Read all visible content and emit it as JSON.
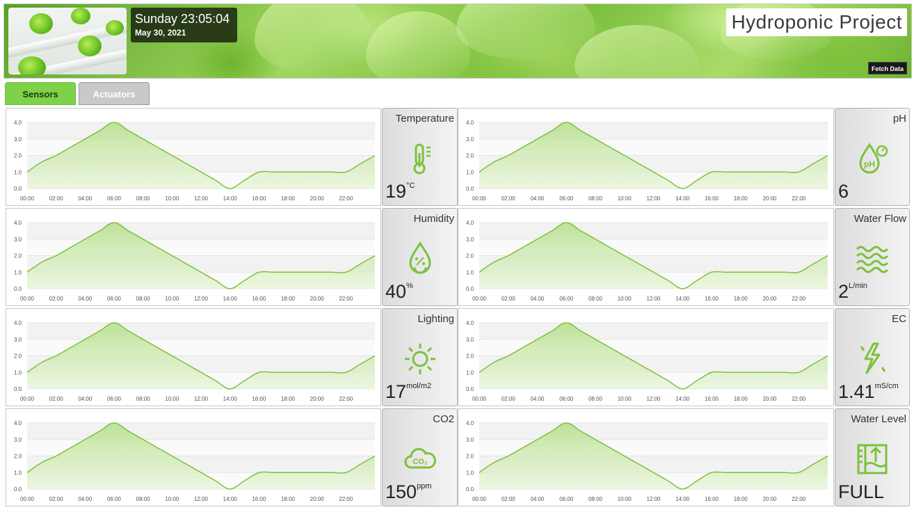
{
  "header": {
    "clock_time": "Sunday 23:05:04",
    "clock_date": "May 30, 2021",
    "title": "Hydroponic Project",
    "fetch_label": "Fetch Data"
  },
  "tabs": [
    {
      "label": "Sensors",
      "active": true
    },
    {
      "label": "Actuators",
      "active": false
    }
  ],
  "sensors": [
    {
      "label": "Temperature",
      "value": "19",
      "unit": "°C",
      "icon": "thermometer-icon"
    },
    {
      "label": "Humidity",
      "value": "40",
      "unit": "%",
      "icon": "humidity-drop-icon"
    },
    {
      "label": "Lighting",
      "value": "17",
      "unit": "mol/m2",
      "icon": "sun-icon"
    },
    {
      "label": "CO2",
      "value": "150",
      "unit": "ppm",
      "icon": "co2-cloud-icon"
    },
    {
      "label": "pH",
      "value": "6",
      "unit": "",
      "icon": "ph-drop-icon"
    },
    {
      "label": "Water Flow",
      "value": "2",
      "unit": "L/min",
      "icon": "water-waves-icon"
    },
    {
      "label": "EC",
      "value": "1.41",
      "unit": "mS/cm",
      "icon": "lightning-icon"
    },
    {
      "label": "Water Level",
      "value": "FULL",
      "unit": "",
      "icon": "water-level-icon"
    }
  ],
  "colors": {
    "accent": "#7ed24a",
    "line": "#7cc13a",
    "fill": "#c9e8a8"
  },
  "chart_data": [
    {
      "type": "area",
      "x": [
        "00:00",
        "01:00",
        "02:00",
        "03:00",
        "04:00",
        "05:00",
        "06:00",
        "07:00",
        "08:00",
        "09:00",
        "10:00",
        "11:00",
        "12:00",
        "13:00",
        "14:00",
        "15:00",
        "16:00",
        "17:00",
        "18:00",
        "19:00",
        "20:00",
        "21:00",
        "22:00",
        "23:00"
      ],
      "values": [
        1.0,
        1.6,
        2.0,
        2.5,
        3.0,
        3.5,
        4.0,
        3.5,
        3.0,
        2.5,
        2.0,
        1.5,
        1.0,
        0.5,
        0.0,
        0.5,
        1.0,
        1.0,
        1.0,
        1.0,
        1.0,
        1.0,
        1.0,
        1.5,
        2.0
      ],
      "xticks": [
        "00:00",
        "02:00",
        "04:00",
        "06:00",
        "08:00",
        "10:00",
        "12:00",
        "14:00",
        "16:00",
        "18:00",
        "20:00",
        "22:00"
      ],
      "yticks": [
        "0.0",
        "1.0",
        "2.0",
        "3.0",
        "4.0"
      ],
      "ylim": [
        0,
        4
      ]
    }
  ]
}
